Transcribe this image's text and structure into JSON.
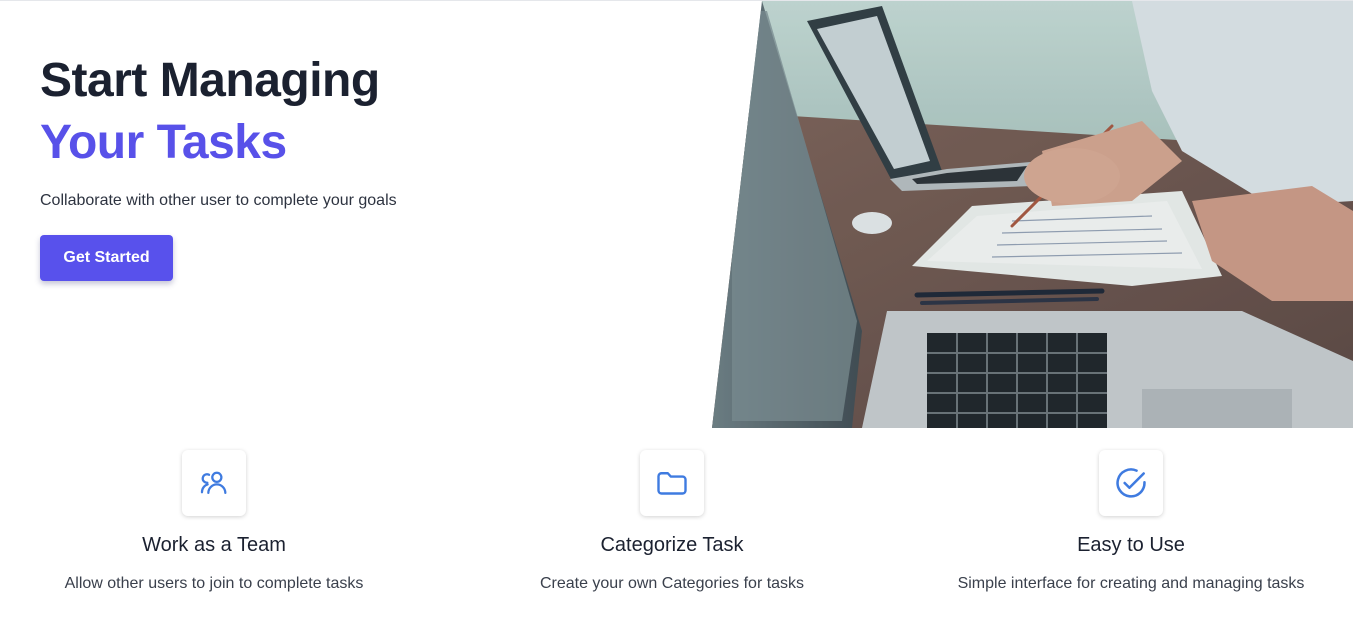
{
  "hero": {
    "title_line1": "Start Managing",
    "title_line2": "Your Tasks",
    "subtitle": "Collaborate with other user to complete your goals",
    "cta_label": "Get Started",
    "image_icon": "laptops-on-desk-photo"
  },
  "features": [
    {
      "icon": "users-icon",
      "title": "Work as a Team",
      "description": "Allow other users to join to complete tasks"
    },
    {
      "icon": "folder-icon",
      "title": "Categorize Task",
      "description": "Create your own Categories for tasks"
    },
    {
      "icon": "check-circle-icon",
      "title": "Easy to Use",
      "description": "Simple interface for creating and managing tasks"
    }
  ],
  "colors": {
    "accent": "#5851e9",
    "button": "#5851ec",
    "icon_blue": "#3f7be0",
    "heading": "#1b2130"
  }
}
